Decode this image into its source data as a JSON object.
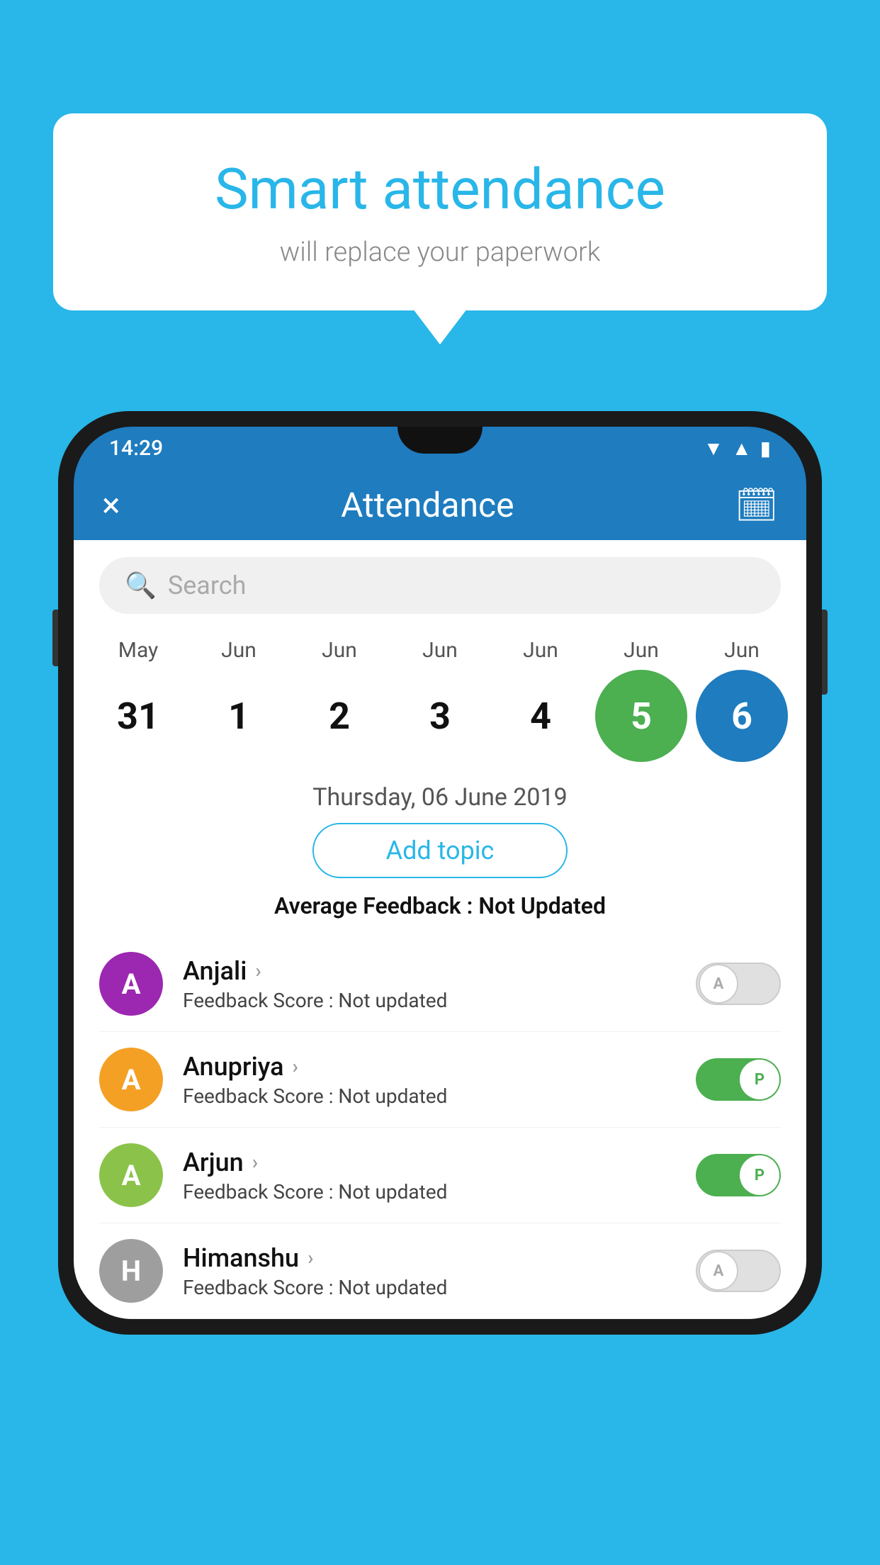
{
  "background_color": "#29b6e8",
  "speech_bubble": {
    "title": "Smart attendance",
    "subtitle": "will replace your paperwork"
  },
  "phone": {
    "status_bar": {
      "time": "14:29",
      "icons": [
        "wifi",
        "signal",
        "battery"
      ]
    },
    "header": {
      "title": "Attendance",
      "close_icon": "×",
      "calendar_icon": "📅"
    },
    "search": {
      "placeholder": "Search"
    },
    "calendar": {
      "months": [
        "May",
        "Jun",
        "Jun",
        "Jun",
        "Jun",
        "Jun",
        "Jun"
      ],
      "dates": [
        "31",
        "1",
        "2",
        "3",
        "4",
        "5",
        "6"
      ],
      "today_index": 4,
      "selected_index": 5,
      "selected_date_label": "Thursday, 06 June 2019"
    },
    "add_topic_label": "Add topic",
    "average_feedback": {
      "label": "Average Feedback : ",
      "value": "Not Updated"
    },
    "students": [
      {
        "name": "Anjali",
        "avatar_letter": "A",
        "avatar_color": "#9c27b0",
        "feedback_label": "Feedback Score : ",
        "feedback_value": "Not updated",
        "status": "absent"
      },
      {
        "name": "Anupriya",
        "avatar_letter": "A",
        "avatar_color": "#f4a025",
        "feedback_label": "Feedback Score : ",
        "feedback_value": "Not updated",
        "status": "present"
      },
      {
        "name": "Arjun",
        "avatar_letter": "A",
        "avatar_color": "#8bc34a",
        "feedback_label": "Feedback Score : ",
        "feedback_value": "Not updated",
        "status": "present"
      },
      {
        "name": "Himanshu",
        "avatar_letter": "H",
        "avatar_color": "#9e9e9e",
        "feedback_label": "Feedback Score : ",
        "feedback_value": "Not updated",
        "status": "absent"
      }
    ]
  }
}
